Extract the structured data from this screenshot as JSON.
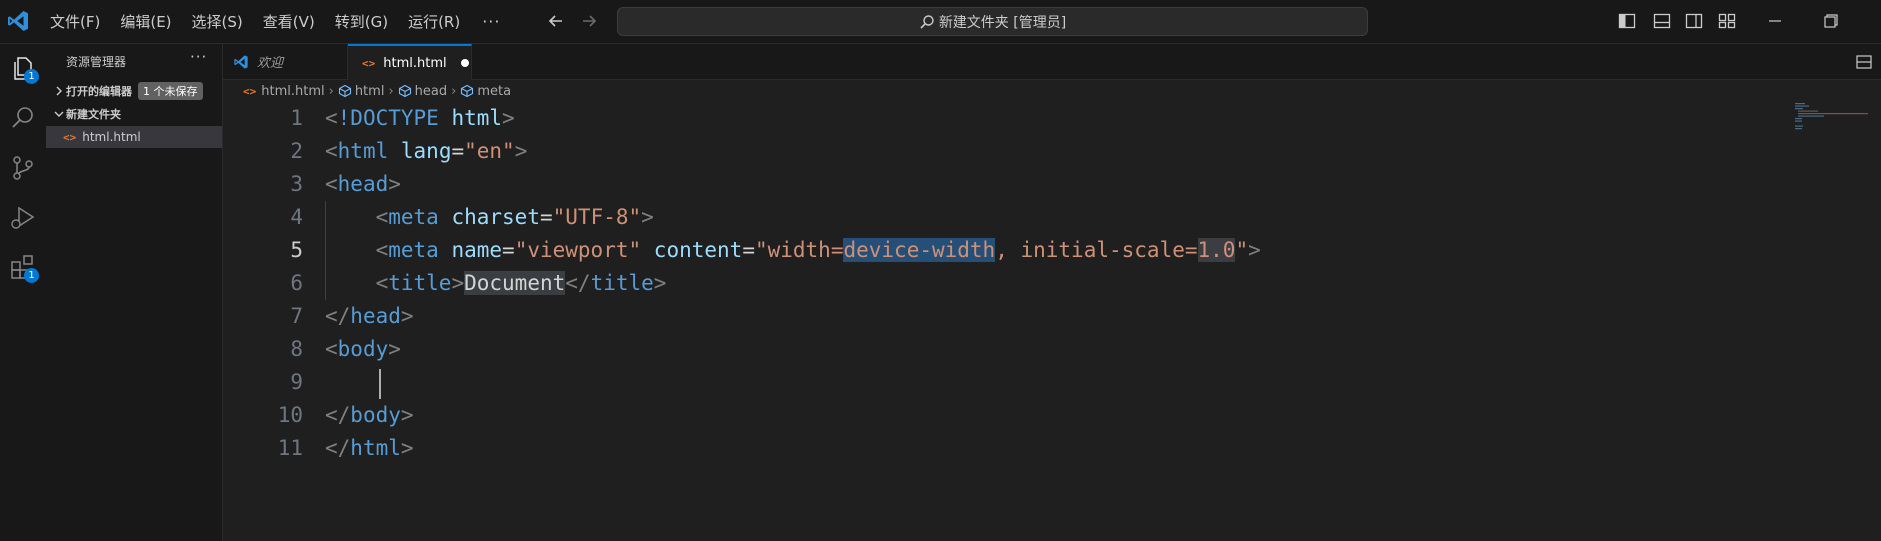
{
  "titlebar": {
    "menus": [
      "文件(F)",
      "编辑(E)",
      "选择(S)",
      "查看(V)",
      "转到(G)",
      "运行(R)"
    ],
    "more": "···",
    "command_center": "新建文件夹 [管理员]"
  },
  "activity": {
    "explorer_badge": "1",
    "extensions_badge": "1"
  },
  "sidebar": {
    "title": "资源管理器",
    "more": "···",
    "open_editors_label": "打开的编辑器",
    "open_editors_badge": "1 个未保存",
    "folder_label": "新建文件夹",
    "file_label": "html.html"
  },
  "tabs": {
    "welcome": "欢迎",
    "active": "html.html"
  },
  "breadcrumb": [
    "html.html",
    "html",
    "head",
    "meta"
  ],
  "editor": {
    "line_numbers": [
      "1",
      "2",
      "3",
      "4",
      "5",
      "6",
      "7",
      "8",
      "9",
      "10",
      "11"
    ],
    "active_line": 5
  },
  "colors": {
    "accent": "#0078d4",
    "tag": "#569cd6",
    "attribute": "#9cdcfe",
    "string": "#ce9178",
    "html_icon": "#e37933"
  }
}
